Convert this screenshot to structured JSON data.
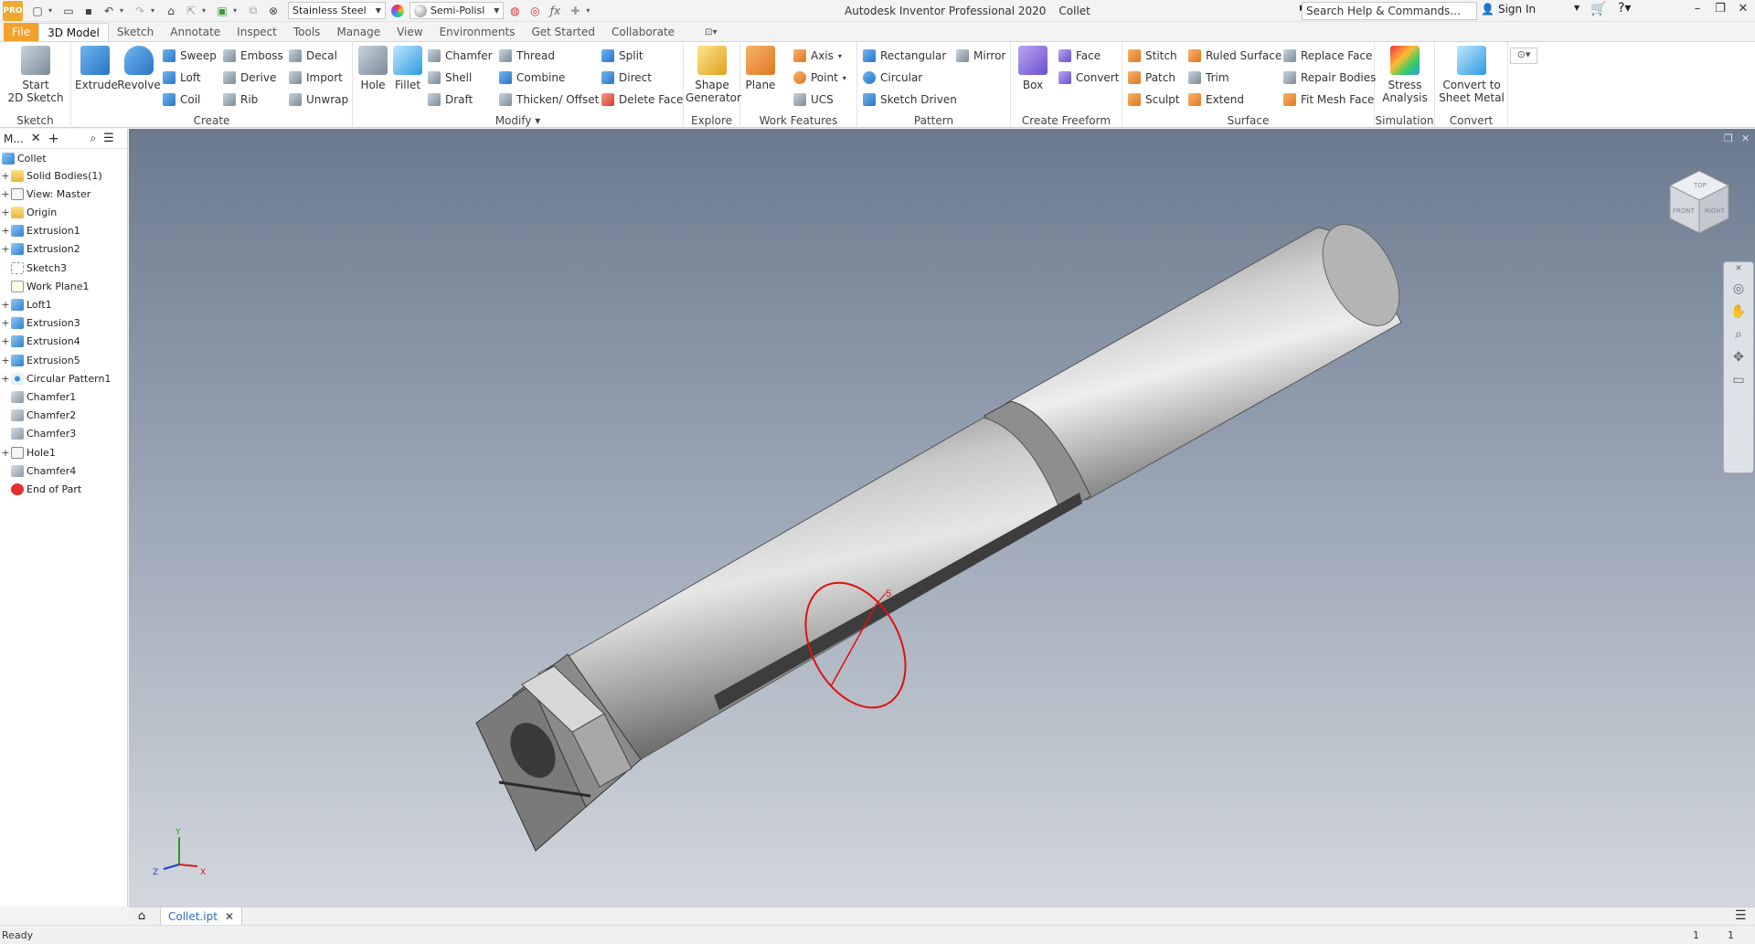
{
  "titlebar": {
    "app_logo": "PRO",
    "material": "Stainless Steel",
    "appearance": "Semi-Polisl",
    "app_title": "Autodesk Inventor Professional 2020",
    "doc_title": "Collet",
    "search_placeholder": "Search Help & Commands...",
    "sign_in": "Sign In"
  },
  "tabs": [
    "File",
    "3D Model",
    "Sketch",
    "Annotate",
    "Inspect",
    "Tools",
    "Manage",
    "View",
    "Environments",
    "Get Started",
    "Collaborate"
  ],
  "active_tab": "3D Model",
  "ribbon": {
    "sketch": {
      "label": "Sketch",
      "start": "Start",
      "start2": "2D Sketch"
    },
    "create": {
      "label": "Create",
      "extrude": "Extrude",
      "revolve": "Revolve",
      "sweep": "Sweep",
      "loft": "Loft",
      "coil": "Coil",
      "emboss": "Emboss",
      "derive": "Derive",
      "rib": "Rib",
      "decal": "Decal",
      "import": "Import",
      "unwrap": "Unwrap"
    },
    "modify": {
      "label": "Modify",
      "hole": "Hole",
      "fillet": "Fillet",
      "chamfer": "Chamfer",
      "shell": "Shell",
      "draft": "Draft",
      "thread": "Thread",
      "combine": "Combine",
      "thicken": "Thicken/ Offset",
      "split": "Split",
      "direct": "Direct",
      "delete_face": "Delete Face"
    },
    "explore": {
      "label": "Explore",
      "shape": "Shape",
      "generator": "Generator"
    },
    "work_features": {
      "label": "Work Features",
      "plane": "Plane",
      "axis": "Axis",
      "point": "Point",
      "ucs": "UCS"
    },
    "pattern": {
      "label": "Pattern",
      "rectangular": "Rectangular",
      "circular": "Circular",
      "sketch_driven": "Sketch Driven",
      "mirror": "Mirror"
    },
    "freeform": {
      "label": "Create Freeform",
      "box": "Box",
      "face": "Face",
      "convert": "Convert"
    },
    "surface": {
      "label": "Surface",
      "stitch": "Stitch",
      "patch": "Patch",
      "sculpt": "Sculpt",
      "ruled": "Ruled Surface",
      "trim": "Trim",
      "extend": "Extend",
      "replace": "Replace Face",
      "repair": "Repair Bodies",
      "fit_mesh": "Fit Mesh Face"
    },
    "simulation": {
      "label": "Simulation",
      "stress": "Stress",
      "analysis": "Analysis"
    },
    "convert": {
      "label": "Convert",
      "to": "Convert to",
      "sheet": "Sheet Metal"
    }
  },
  "browser": {
    "title": "M...",
    "root": "Collet",
    "items": [
      {
        "label": "Solid Bodies(1)",
        "icon": "folder-icon",
        "exp": "+"
      },
      {
        "label": "View: Master",
        "icon": "view-icon",
        "exp": "+"
      },
      {
        "label": "Origin",
        "icon": "folder-icon",
        "exp": "+"
      },
      {
        "label": "Extrusion1",
        "icon": "extrusion-icon",
        "exp": "+"
      },
      {
        "label": "Extrusion2",
        "icon": "extrusion-icon",
        "exp": "+"
      },
      {
        "label": "Sketch3",
        "icon": "sketch-icon",
        "exp": ""
      },
      {
        "label": "Work Plane1",
        "icon": "work-plane-icon",
        "exp": ""
      },
      {
        "label": "Loft1",
        "icon": "loft-icon",
        "exp": "+"
      },
      {
        "label": "Extrusion3",
        "icon": "extrusion-icon",
        "exp": "+"
      },
      {
        "label": "Extrusion4",
        "icon": "extrusion-icon",
        "exp": "+"
      },
      {
        "label": "Extrusion5",
        "icon": "extrusion-icon",
        "exp": "+"
      },
      {
        "label": "Circular Pattern1",
        "icon": "circular-pattern-icon",
        "exp": "+"
      },
      {
        "label": "Chamfer1",
        "icon": "chamfer-icon",
        "exp": ""
      },
      {
        "label": "Chamfer2",
        "icon": "chamfer-icon",
        "exp": ""
      },
      {
        "label": "Chamfer3",
        "icon": "chamfer-icon",
        "exp": ""
      },
      {
        "label": "Hole1",
        "icon": "hole-icon",
        "exp": "+"
      },
      {
        "label": "Chamfer4",
        "icon": "chamfer-icon",
        "exp": ""
      },
      {
        "label": "End of Part",
        "icon": "end-of-part-icon",
        "exp": ""
      }
    ]
  },
  "viewport": {
    "sketch_dim": "5",
    "axis_x": "X",
    "axis_y": "Y",
    "axis_z": "Z",
    "cube_top": "TOP",
    "cube_front": "FRONT",
    "cube_right": "RIGHT"
  },
  "doc_tab": "Collet.ipt",
  "status": {
    "text": "Ready",
    "n1": "1",
    "n2": "1"
  }
}
